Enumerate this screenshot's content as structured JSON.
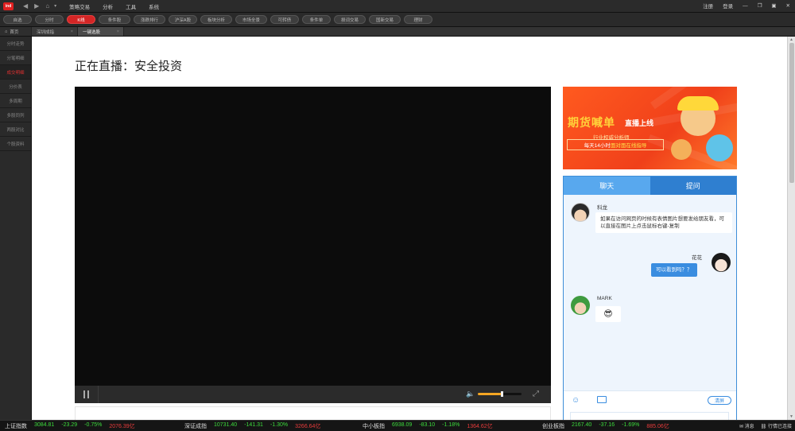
{
  "titlebar": {
    "logo": "ind",
    "menu": [
      "策略交易",
      "分析",
      "工具",
      "系统"
    ],
    "login": "注册",
    "register": "登录"
  },
  "toolbar": {
    "buttons": [
      "自选",
      "分时",
      "K线",
      "条件股",
      "涨跌排行",
      "沪深A股",
      "板块分析",
      "市场全景",
      "可转债",
      "条件单",
      "损词交易",
      "国新交易",
      "理财"
    ]
  },
  "tabs": {
    "home": "首页",
    "items": [
      "深圳成指",
      "一键选股"
    ]
  },
  "sidebar": {
    "items": [
      "分时走势",
      "分笔明细",
      "成交明细",
      "分价表",
      "多周期",
      "多股同列",
      "两股对比",
      "个股资料"
    ]
  },
  "main": {
    "title": "正在直播：安全投资"
  },
  "player": {
    "volume": 0.55
  },
  "banner": {
    "title": "期货喊单",
    "subtitle": "直播上线",
    "line1": "行业权威分析师",
    "line2_pre": "每天14小时",
    "line2_hl": "面对面在线指导"
  },
  "chat": {
    "tab_chat": "聊天",
    "tab_ask": "提问",
    "messages": [
      {
        "name": "科龙",
        "text": "如果在访问网页的时候有表情图片想要发给朋友看，可以直接在图片上点击鼠标右键-复制"
      },
      {
        "name": "花花",
        "text": "可以看到吗？？"
      },
      {
        "name": "MARK",
        "text": ""
      }
    ],
    "clear": "清屏"
  },
  "status": {
    "indices": [
      {
        "name": "上证指数",
        "value": "3084.81",
        "change": "-23.29",
        "pct": "-0.75%",
        "amount": "2076.39亿"
      },
      {
        "name": "深证成指",
        "value": "10731.40",
        "change": "-141.31",
        "pct": "-1.30%",
        "amount": "3266.64亿"
      },
      {
        "name": "中小板指",
        "value": "6938.09",
        "change": "-83.10",
        "pct": "-1.18%",
        "amount": "1364.62亿"
      },
      {
        "name": "创业板指",
        "value": "2167.40",
        "change": "-37.16",
        "pct": "-1.69%",
        "amount": "885.06亿"
      }
    ],
    "messages": "消息",
    "connected": "行情已连接"
  },
  "colors": {
    "accent_red": "#d42525",
    "chat_blue": "#3a8de0",
    "down_green": "#3ddc3d",
    "volume_orange": "#f5a623"
  }
}
